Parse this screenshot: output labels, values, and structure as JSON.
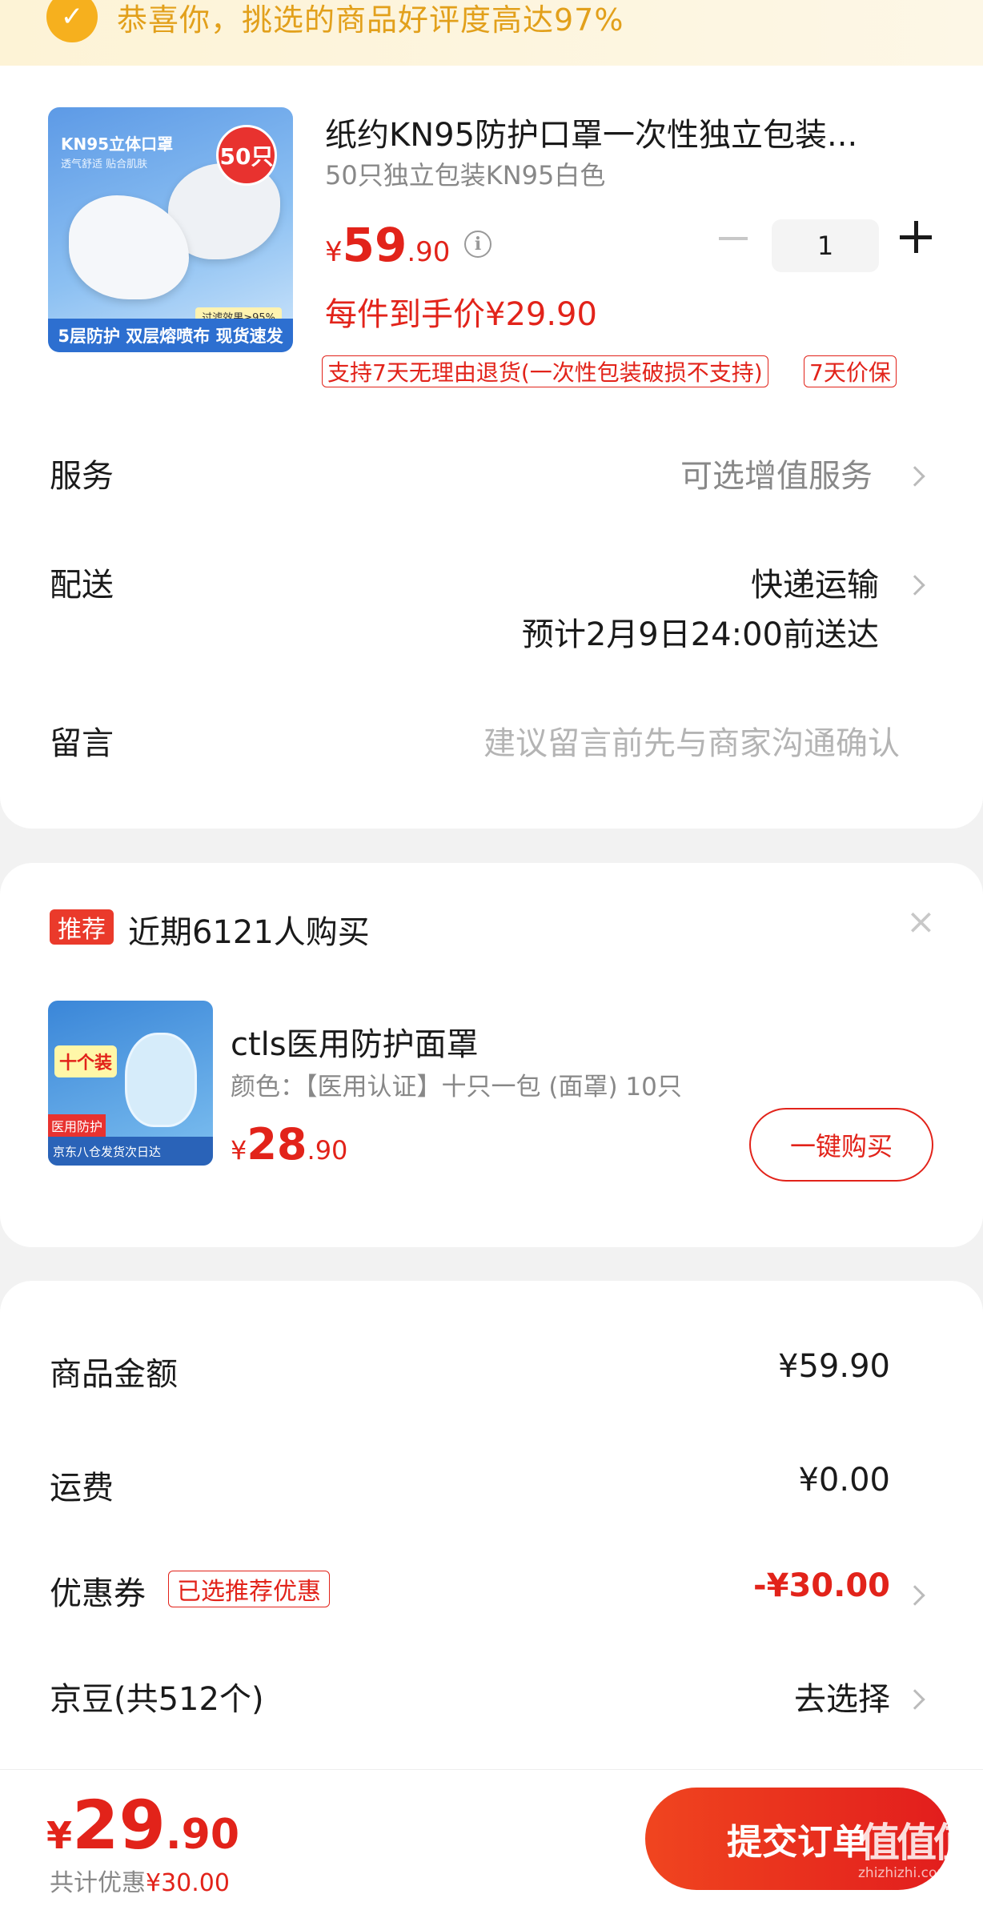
{
  "banner": {
    "text": "恭喜你，挑选的商品好评度高达97%"
  },
  "product": {
    "image_title": "KN95立体口罩",
    "image_sub": "透气舒适 贴合肌肤",
    "image_badge": "50只",
    "image_filter": "过滤效果≥95%",
    "image_bottom": "5层防护 双层熔喷布 现货速发",
    "title": "纸约KN95防护口罩一次性独立包装...",
    "spec": "50只独立包装KN95白色",
    "price_symbol": "¥",
    "price_int": "59",
    "price_dec": ".90",
    "quantity": "1",
    "unit_price_label": "每件到手价¥29.90",
    "tag_return": "支持7天无理由退货(一次性包装破损不支持)",
    "tag_price_protect": "7天价保"
  },
  "rows": {
    "service_label": "服务",
    "service_value": "可选增值服务",
    "delivery_label": "配送",
    "delivery_value": "快递运输",
    "delivery_eta": "预计2月9日24:00前送达",
    "message_label": "留言",
    "message_placeholder": "建议留言前先与商家沟通确认"
  },
  "recommend": {
    "tag": "推荐",
    "title": "近期6121人购买",
    "close": "×",
    "image_tag": "十个装",
    "image_med": "医用防护",
    "image_bottom": "京东八仓发货次日达",
    "name": "ctls医用防护面罩",
    "spec": "颜色：【医用认证】十只一包 (面罩) 10只",
    "price_symbol": "¥",
    "price_int": "28",
    "price_dec": ".90",
    "buy_label": "一键购买"
  },
  "summary": {
    "goods_label": "商品金额",
    "goods_value": "¥59.90",
    "shipping_label": "运费",
    "shipping_value": "¥0.00",
    "coupon_label": "优惠券",
    "coupon_chip": "已选推荐优惠",
    "coupon_value": "-¥30.00",
    "jd_beans_label": "京豆(共512个)",
    "jd_beans_value": "去选择"
  },
  "footer": {
    "total_symbol": "¥",
    "total_int": "29",
    "total_dec": ".90",
    "saved_label": "共计优惠",
    "saved_value": "¥30.00",
    "submit_label": "提交订单",
    "watermark": "值值值",
    "watermark_sub": "zhizhizhi.com"
  },
  "colors": {
    "accent": "#e2231a",
    "banner_text": "#e2a01b",
    "muted": "#888888"
  }
}
